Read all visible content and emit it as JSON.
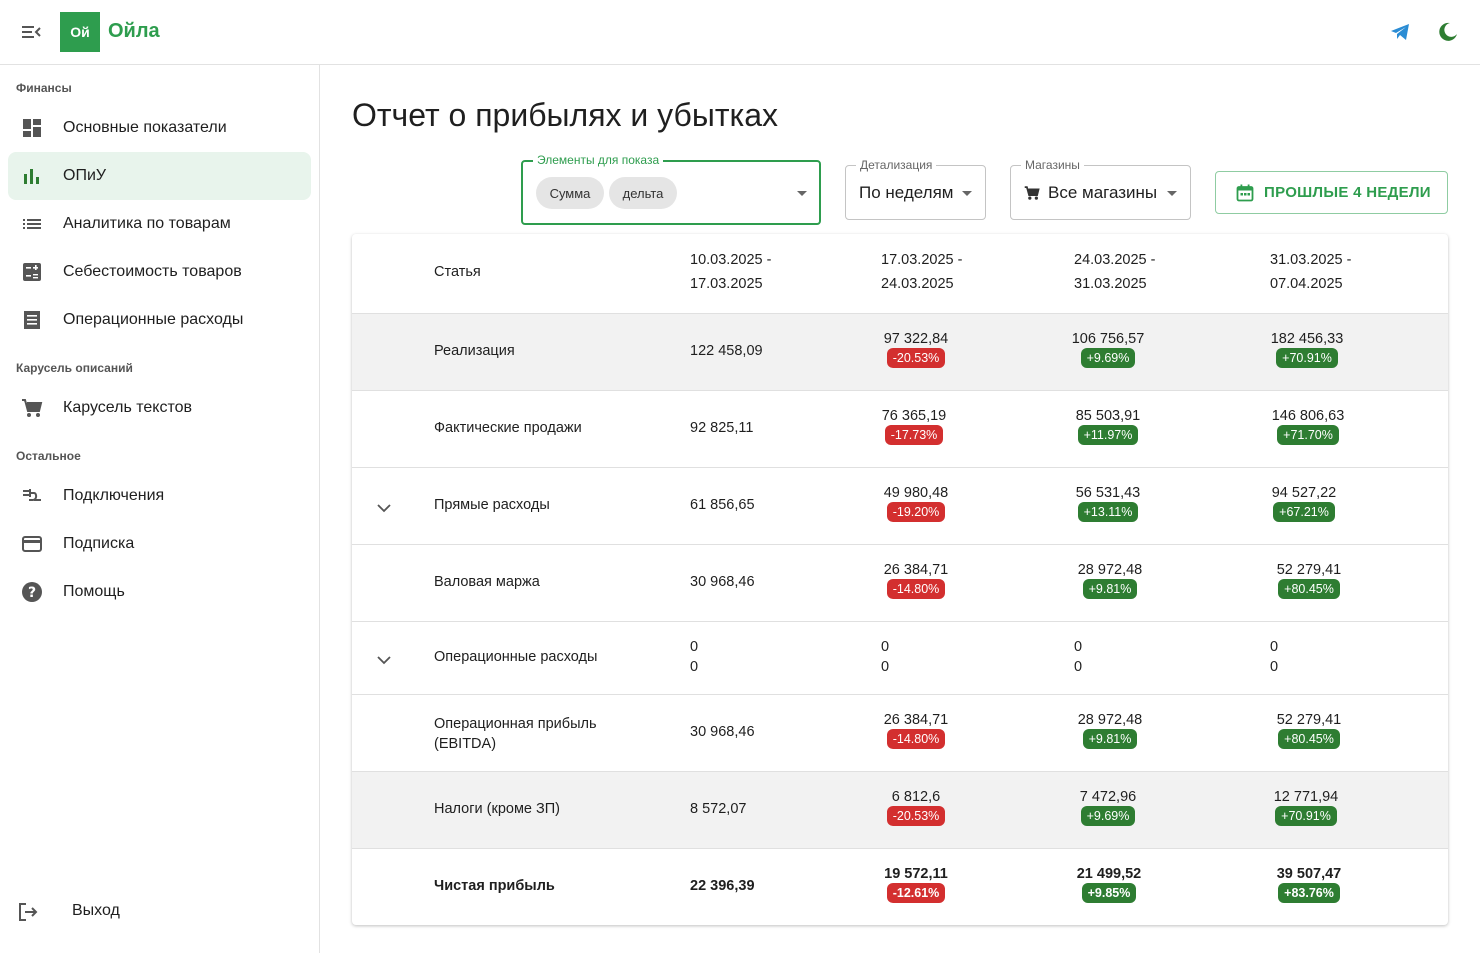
{
  "app": {
    "logo_mark": "Ой",
    "logo_name": "Ойла"
  },
  "topbar": {
    "menu_icon": "menu-collapse-icon",
    "telegram_icon": "telegram-icon",
    "theme_icon": "moon-icon"
  },
  "sidebar": {
    "sections": [
      {
        "title": "Финансы"
      },
      {
        "title": "Карусель описаний"
      },
      {
        "title": "Остальное"
      }
    ],
    "items": [
      {
        "label": "Основные показатели",
        "icon": "dashboard-icon"
      },
      {
        "label": "ОПиУ",
        "icon": "bar-chart-icon",
        "active": true
      },
      {
        "label": "Аналитика по товарам",
        "icon": "list-icon"
      },
      {
        "label": "Себестоимость товаров",
        "icon": "calculator-icon"
      },
      {
        "label": "Операционные расходы",
        "icon": "receipt-icon"
      },
      {
        "label": "Карусель текстов",
        "icon": "cart-icon"
      },
      {
        "label": "Подключения",
        "icon": "plug-icon"
      },
      {
        "label": "Подписка",
        "icon": "credit-card-icon"
      },
      {
        "label": "Помощь",
        "icon": "help-icon"
      }
    ],
    "logout": {
      "label": "Выход",
      "icon": "logout-icon"
    }
  },
  "page": {
    "title": "Отчет о прибылях и убытках"
  },
  "filters": {
    "elements": {
      "legend": "Элементы для показа",
      "chips": [
        "Сумма",
        "дельта"
      ]
    },
    "detail": {
      "legend": "Детализация",
      "value": "По неделям"
    },
    "shops": {
      "legend": "Магазины",
      "value": "Все магазины"
    },
    "period_button": "ПРОШЛЫЕ 4 НЕДЕЛИ"
  },
  "colors": {
    "accent": "#2e9d4e",
    "negative": "#d32f2f",
    "positive": "#2e7d32"
  },
  "table": {
    "header": {
      "article": "Статья",
      "periods": [
        [
          "10.03.2025 -",
          "17.03.2025"
        ],
        [
          "17.03.2025 -",
          "24.03.2025"
        ],
        [
          "24.03.2025 -",
          "31.03.2025"
        ],
        [
          "31.03.2025 -",
          "07.04.2025"
        ]
      ]
    },
    "rows": [
      {
        "name": "Реализация",
        "first": "122 458,09",
        "cols": [
          {
            "value": "97 322,84",
            "delta": "-20.53%"
          },
          {
            "value": "106 756,57",
            "delta": "+9.69%"
          },
          {
            "value": "182 456,33",
            "delta": "+70.91%"
          }
        ]
      },
      {
        "name": "Фактические продажи",
        "first": "92 825,11",
        "cols": [
          {
            "value": "76 365,19",
            "delta": "-17.73%"
          },
          {
            "value": "85 503,91",
            "delta": "+11.97%"
          },
          {
            "value": "146 806,63",
            "delta": "+71.70%"
          }
        ]
      },
      {
        "name": "Прямые расходы",
        "first": "61 856,65",
        "cols": [
          {
            "value": "49 980,48",
            "delta": "-19.20%"
          },
          {
            "value": "56 531,43",
            "delta": "+13.11%"
          },
          {
            "value": "94 527,22",
            "delta": "+67.21%"
          }
        ]
      },
      {
        "name": "Валовая маржа",
        "first": "30 968,46",
        "cols": [
          {
            "value": "26 384,71",
            "delta": "-14.80%"
          },
          {
            "value": "28 972,48",
            "delta": "+9.81%"
          },
          {
            "value": "52 279,41",
            "delta": "+80.45%"
          }
        ]
      },
      {
        "name": "Операционные расходы",
        "first": [
          "0",
          "0"
        ],
        "cols": [
          [
            "0",
            "0"
          ],
          [
            "0",
            "0"
          ],
          [
            "0",
            "0"
          ]
        ]
      },
      {
        "name": [
          "Операционная прибыль",
          "(EBITDA)"
        ],
        "first": "30 968,46",
        "cols": [
          {
            "value": "26 384,71",
            "delta": "-14.80%"
          },
          {
            "value": "28 972,48",
            "delta": "+9.81%"
          },
          {
            "value": "52 279,41",
            "delta": "+80.45%"
          }
        ]
      },
      {
        "name": "Налоги (кроме ЗП)",
        "first": "8 572,07",
        "cols": [
          {
            "value": "6 812,6",
            "delta": "-20.53%"
          },
          {
            "value": "7 472,96",
            "delta": "+9.69%"
          },
          {
            "value": "12 771,94",
            "delta": "+70.91%"
          }
        ]
      },
      {
        "name": "Чистая прибыль",
        "first": "22 396,39",
        "cols": [
          {
            "value": "19 572,11",
            "delta": "-12.61%"
          },
          {
            "value": "21 499,52",
            "delta": "+9.85%"
          },
          {
            "value": "39 507,47",
            "delta": "+83.76%"
          }
        ]
      }
    ]
  }
}
